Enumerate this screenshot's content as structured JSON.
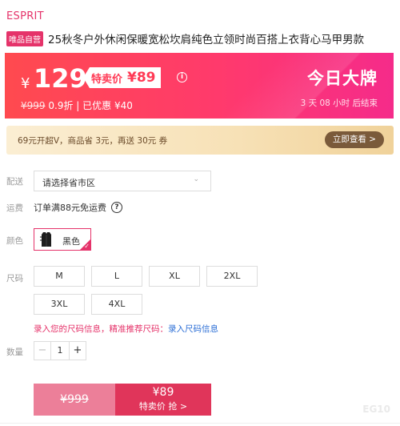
{
  "brand": "ESPRIT",
  "product": {
    "vip_tag": "唯品自营",
    "title": "25秋冬户外休闲保暖宽松坎肩纯色立领时尚百搭上衣背心马甲男款"
  },
  "price": {
    "currency": "¥",
    "price": "129",
    "special_label": "特卖价",
    "special_price": "¥89",
    "original": "¥999",
    "discount": "0.9折",
    "saved": "已优惠 ¥40",
    "today_label": "今日大牌",
    "countdown": "3 天 08 小时 后结束",
    "colors": {
      "start": "#ff4a4f",
      "end": "#f52b8a"
    }
  },
  "vip_strip": {
    "text": "69元开超V，商品省 3元，再送 30元 券",
    "button": "立即查看 >"
  },
  "delivery": {
    "label": "配送",
    "select_value": "请选择省市区"
  },
  "shipping": {
    "label": "运费",
    "text": "订单满88元免运费"
  },
  "color": {
    "label": "颜色",
    "option": "黑色",
    "selected": true,
    "accent": "#e5336a"
  },
  "size": {
    "label": "尺码",
    "options": [
      "M",
      "L",
      "XL",
      "2XL",
      "3XL",
      "4XL"
    ],
    "hint": "录入您的尺码信息，精准推荐尺码：",
    "hint_link": "录入尺码信息"
  },
  "quantity": {
    "label": "数量",
    "minus": "−",
    "value": "1",
    "plus": "+"
  },
  "buy": {
    "original": "¥999",
    "price": "¥89",
    "label": "特卖价 抢 >"
  },
  "corner_logo": "EG10"
}
